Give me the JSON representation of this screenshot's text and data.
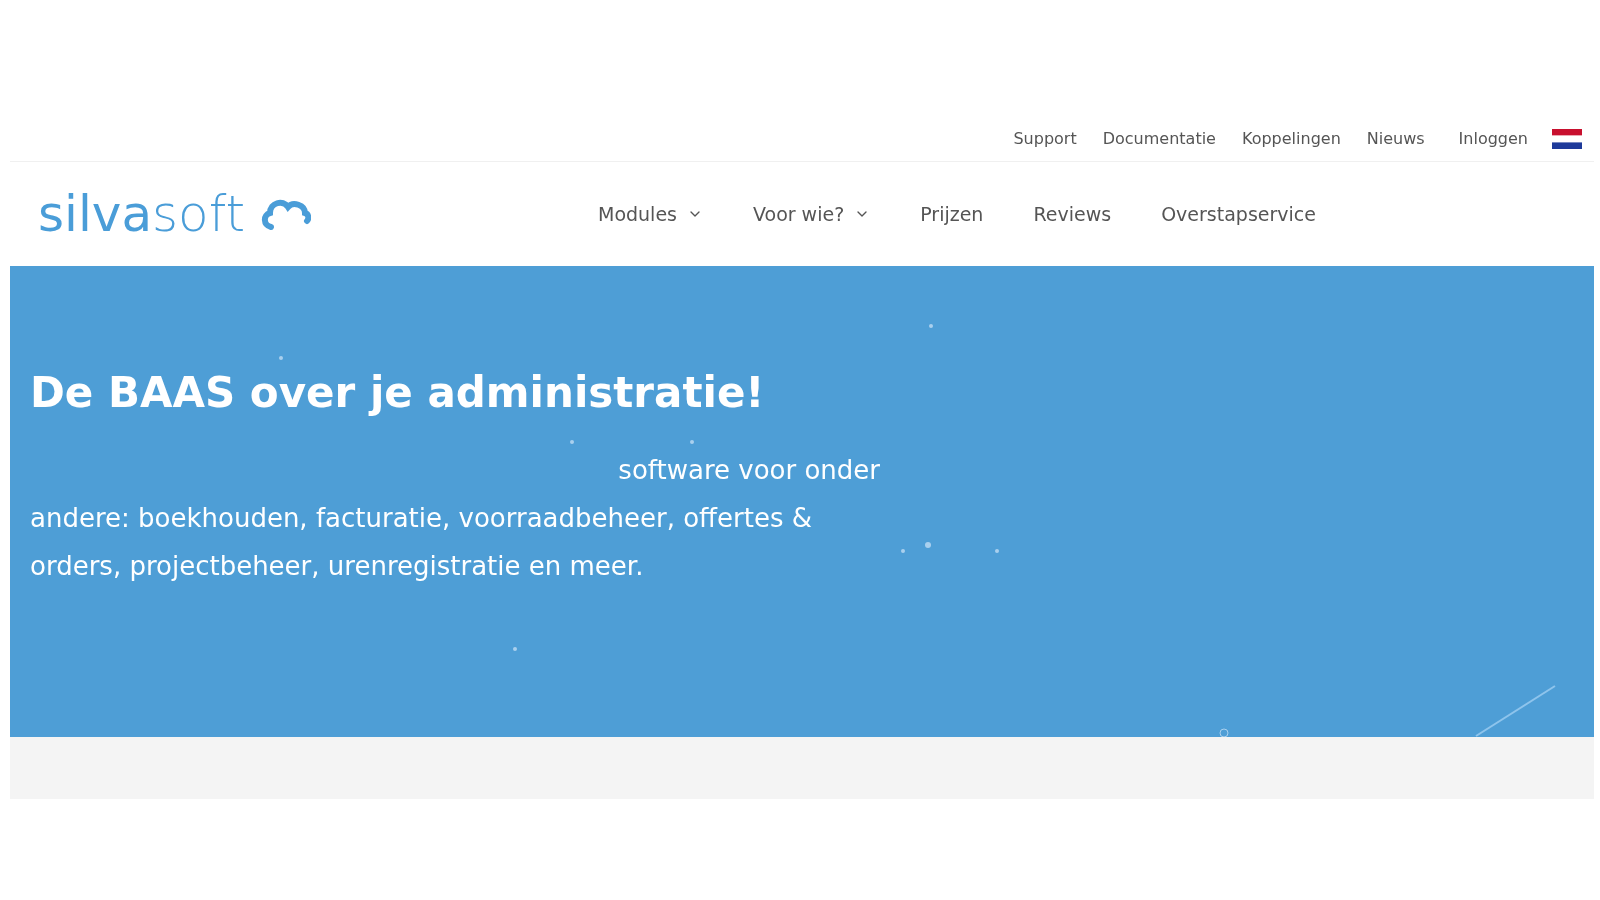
{
  "top_links": [
    {
      "label": "Support"
    },
    {
      "label": "Documentatie"
    },
    {
      "label": "Koppelingen"
    },
    {
      "label": "Nieuws"
    },
    {
      "label": "Inloggen"
    }
  ],
  "logo": "**silva**soft",
  "nav": [
    {
      "label": "Modules",
      "dropdown": true
    },
    {
      "label": "Voor wie?",
      "dropdown": true
    },
    {
      "label": "Prijzen",
      "dropdown": false
    },
    {
      "label": "Reviews",
      "dropdown": false
    },
    {
      "label": "Overstapservice",
      "dropdown": false
    }
  ],
  "hero": {
    "title": "De BAAS over je administratie!",
    "lines": [
      "software voor onder",
      "andere: boekhouden, facturatie, voorraadbeheer, offertes &",
      "orders, projectbeheer, urenregistratie en meer."
    ]
  }
}
